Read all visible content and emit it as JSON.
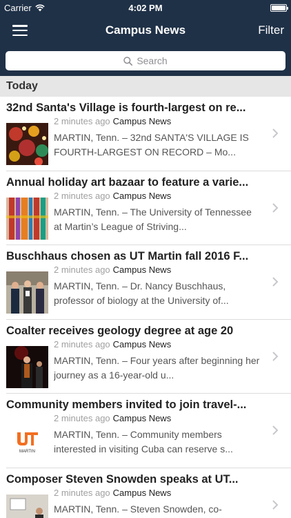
{
  "status_bar": {
    "carrier": "Carrier",
    "time": "4:02 PM"
  },
  "nav": {
    "title": "Campus News",
    "filter_label": "Filter"
  },
  "search": {
    "placeholder": "Search"
  },
  "section": {
    "title": "Today"
  },
  "colors": {
    "nav_bg": "#1f3147",
    "section_bg": "#e6e6e6",
    "meta_gray": "#a0a0a0",
    "ut_orange": "#f26f21"
  },
  "items": [
    {
      "title": "32nd Santa's Village is fourth-largest on re...",
      "ago": "2 minutes ago",
      "category": "Campus News",
      "desc": "MARTIN, Tenn. – 32nd SANTA'S VILLAGE IS FOURTH-LARGEST ON RECORD – Mo...",
      "thumb": "christmas-ornaments-photo"
    },
    {
      "title": "Annual holiday art bazaar to feature a varie...",
      "ago": "2 minutes ago",
      "category": "Campus News",
      "desc": "MARTIN, Tenn. – The University of Tennessee at Martin’s League of Striving...",
      "thumb": "art-bazaar-photo"
    },
    {
      "title": "Buschhaus chosen as UT Martin fall 2016 F...",
      "ago": "2 minutes ago",
      "category": "Campus News",
      "desc": "MARTIN, Tenn. – Dr. Nancy Buschhaus, professor of biology at the University of...",
      "thumb": "award-group-photo"
    },
    {
      "title": "Coalter receives geology degree at age 20",
      "ago": "2 minutes ago",
      "category": "Campus News",
      "desc": "MARTIN, Tenn. – Four years after beginning her journey as a 16-year-old u...",
      "thumb": "graduation-photo"
    },
    {
      "title": "Community members invited to join travel-...",
      "ago": "2 minutes ago",
      "category": "Campus News",
      "desc": "MARTIN, Tenn. – Community members interested in visiting Cuba can reserve s...",
      "thumb": "ut-martin-logo",
      "logo_text": "MARTIN"
    },
    {
      "title": "Composer Steven Snowden speaks at UT...",
      "ago": "2 minutes ago",
      "category": "Campus News",
      "desc": "MARTIN, Tenn. – Steven Snowden, co-",
      "thumb": "speaker-photo"
    }
  ]
}
